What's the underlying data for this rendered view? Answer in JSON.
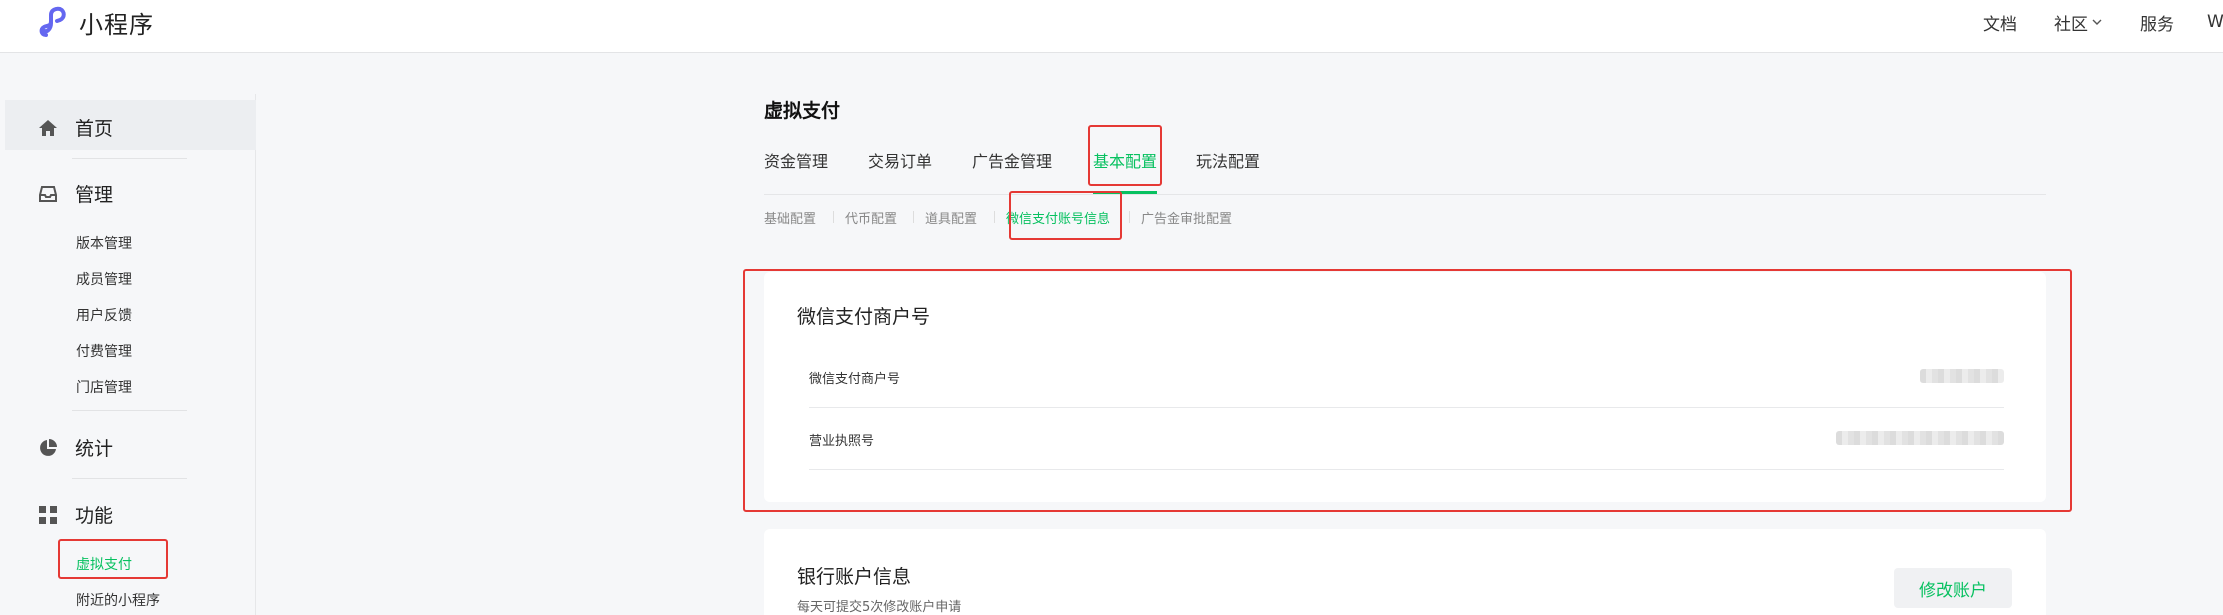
{
  "brand": {
    "name": "小程序",
    "logo_icon": "miniprogram-logo-icon"
  },
  "topnav": [
    {
      "label": "文档"
    },
    {
      "label": "社区",
      "has_dropdown": true
    },
    {
      "label": "服务"
    },
    {
      "label": "W"
    }
  ],
  "sidebar": {
    "home": {
      "label": "首页",
      "icon": "home-icon"
    },
    "manage": {
      "label": "管理",
      "icon": "inbox-icon",
      "items": [
        "版本管理",
        "成员管理",
        "用户反馈",
        "付费管理",
        "门店管理"
      ]
    },
    "stats": {
      "label": "统计",
      "icon": "pie-chart-icon"
    },
    "features": {
      "label": "功能",
      "icon": "grid-icon",
      "items": [
        "虚拟支付",
        "附近的小程序"
      ],
      "active_item": "虚拟支付"
    }
  },
  "main": {
    "title": "虚拟支付",
    "tabs": [
      "资金管理",
      "交易订单",
      "广告金管理",
      "基本配置",
      "玩法配置"
    ],
    "active_tab": "基本配置",
    "subtabs": [
      "基础配置",
      "代币配置",
      "道具配置",
      "微信支付账号信息",
      "广告金审批配置"
    ],
    "active_subtab": "微信支付账号信息",
    "merchant_card": {
      "title": "微信支付商户号",
      "rows": [
        {
          "label": "微信支付商户号"
        },
        {
          "label": "营业执照号"
        }
      ]
    },
    "bank_card": {
      "title": "银行账户信息",
      "hint": "每天可提交5次修改账户申请",
      "button": "修改账户"
    }
  },
  "colors": {
    "accent": "#07c160",
    "highlight": "#e53935"
  }
}
